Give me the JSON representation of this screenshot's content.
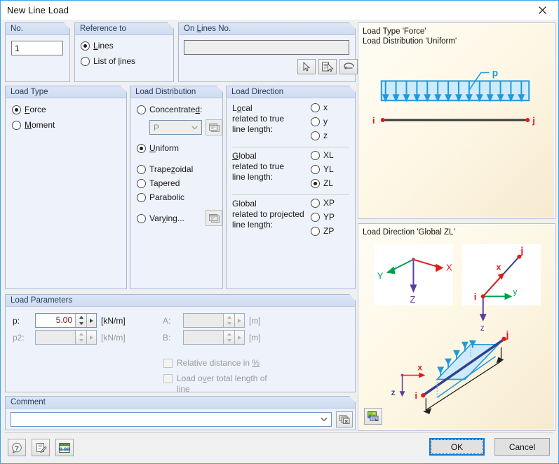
{
  "window": {
    "title": "New Line Load",
    "close_icon": "close-icon"
  },
  "no_group": {
    "title": "No.",
    "value": "1"
  },
  "reference_group": {
    "title": "Reference to",
    "options": [
      {
        "label": "Lines",
        "mnemonic": "L",
        "selected": true
      },
      {
        "label": "List of lines",
        "mnemonic": "L",
        "selected": false
      }
    ]
  },
  "on_lines_group": {
    "title": "On Lines No.",
    "title_mnemonic": "L",
    "value": "",
    "buttons": [
      {
        "name": "pick-line-icon",
        "tooltip": "Select single"
      },
      {
        "name": "pick-from-list-icon",
        "tooltip": "Select from list"
      },
      {
        "name": "select-loop-icon",
        "tooltip": "Select by loop"
      }
    ]
  },
  "load_type_group": {
    "title": "Load Type",
    "options": [
      {
        "label": "Force",
        "mnemonic": "F",
        "selected": true
      },
      {
        "label": "Moment",
        "mnemonic": "M",
        "selected": false
      }
    ]
  },
  "load_distribution_group": {
    "title": "Load Distribution",
    "concentrated": {
      "label": "Concentrated:",
      "mnemonic": "d",
      "selected": false,
      "dropdown_value": "P",
      "dropdown_enabled": false,
      "button_icon": "dialog-window-icon"
    },
    "options": [
      {
        "label": "Uniform",
        "mnemonic": "U",
        "selected": true
      },
      {
        "label": "Trapezoidal",
        "mnemonic": "z",
        "selected": false
      },
      {
        "label": "Tapered",
        "mnemonic": "",
        "selected": false
      },
      {
        "label": "Parabolic",
        "mnemonic": "",
        "selected": false
      }
    ],
    "varying": {
      "label": "Varying...",
      "mnemonic": "y",
      "selected": false,
      "button_icon": "dialog-window-icon"
    }
  },
  "load_direction_group": {
    "title": "Load Direction",
    "sections": [
      {
        "label_lines": [
          "Local",
          "related to true",
          "line length:"
        ],
        "mnemonic": "o",
        "options": [
          {
            "label": "x",
            "selected": false
          },
          {
            "label": "y",
            "selected": false
          },
          {
            "label": "z",
            "selected": false
          }
        ]
      },
      {
        "label_lines": [
          "Global",
          "related to true",
          "line length:"
        ],
        "mnemonic": "G",
        "options": [
          {
            "label": "XL",
            "selected": false
          },
          {
            "label": "YL",
            "selected": false
          },
          {
            "label": "ZL",
            "selected": true
          }
        ]
      },
      {
        "label_lines": [
          "Global",
          "related to projected",
          "line length:"
        ],
        "mnemonic": "g",
        "options": [
          {
            "label": "XP",
            "selected": false
          },
          {
            "label": "YP",
            "selected": false
          },
          {
            "label": "ZP",
            "selected": false
          }
        ]
      }
    ]
  },
  "load_parameters_group": {
    "title": "Load Parameters",
    "fields": [
      {
        "label": "p:",
        "value": "5.00",
        "unit": "[kN/m]",
        "enabled": true
      },
      {
        "label": "p2:",
        "value": "",
        "unit": "[kN/m]",
        "enabled": false
      },
      {
        "label": "A:",
        "value": "",
        "unit": "[m]",
        "enabled": false
      },
      {
        "label": "B:",
        "value": "",
        "unit": "[m]",
        "enabled": false
      }
    ],
    "checkboxes": [
      {
        "label": "Relative distance in %",
        "mnemonic": "%",
        "checked": false,
        "enabled": false
      },
      {
        "label": "Load over total length of",
        "label2": "line",
        "mnemonic": "v",
        "checked": false,
        "enabled": false
      }
    ]
  },
  "comment_group": {
    "title": "Comment",
    "value": "",
    "button_icon": "comment-library-icon"
  },
  "preview_top": {
    "line1": "Load Type 'Force'",
    "line2": "Load Distribution 'Uniform'",
    "labels": {
      "load": "p",
      "start_node": "i",
      "end_node": "j"
    }
  },
  "preview_bottom": {
    "title": "Load Direction 'Global ZL'",
    "global_axes": {
      "x": "X",
      "y": "Y",
      "z": "Z"
    },
    "local_axes": {
      "x": "x",
      "y": "y",
      "z": "z",
      "start_node": "i",
      "end_node": "j"
    },
    "scene_labels": {
      "x": "x",
      "z": "z",
      "start_node": "i",
      "end_node": "j"
    },
    "button_icon": "render-settings-icon"
  },
  "toolbar": [
    {
      "name": "help-icon",
      "label": "?"
    },
    {
      "name": "edit-notes-icon",
      "label": ""
    },
    {
      "name": "units-icon",
      "label": "0.00"
    }
  ],
  "dialog_buttons": {
    "ok": "OK",
    "cancel": "Cancel"
  },
  "colors": {
    "accent": "#3ba7e8",
    "group_header": "#dbe6f6",
    "group_bg": "#eef2fa",
    "value_text": "#7b2222",
    "load_blue": "#1e9ade",
    "node_red": "#e01b1b",
    "axis_green": "#00a050",
    "axis_purple": "#5a3fa0"
  }
}
